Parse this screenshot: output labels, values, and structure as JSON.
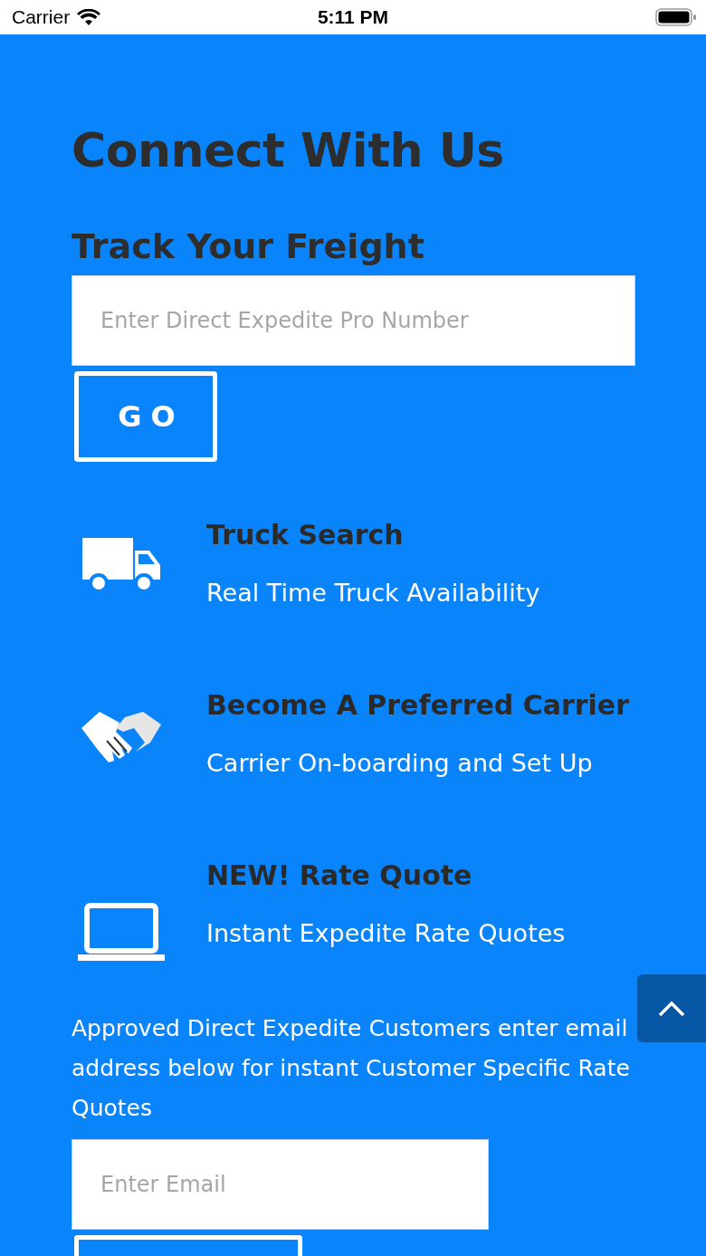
{
  "status_bar": {
    "carrier": "Carrier",
    "time": "5:11 PM"
  },
  "title": "Connect With Us",
  "track": {
    "heading": "Track Your Freight",
    "placeholder": "Enter Direct Expedite Pro Number",
    "button": "GO"
  },
  "features": [
    {
      "kind": "truck",
      "title": "Truck Search",
      "subtitle": "Real Time Truck Availability"
    },
    {
      "kind": "handshake",
      "title": "Become A Preferred Carrier",
      "subtitle": "Carrier On-boarding and Set Up"
    },
    {
      "kind": "laptop",
      "title": "NEW! Rate Quote",
      "subtitle": "Instant Expedite Rate Quotes"
    }
  ],
  "customers": {
    "text": "Approved Direct Expedite Customers enter email address below for instant Customer Specific Rate Quotes",
    "placeholder": "Enter Email"
  }
}
